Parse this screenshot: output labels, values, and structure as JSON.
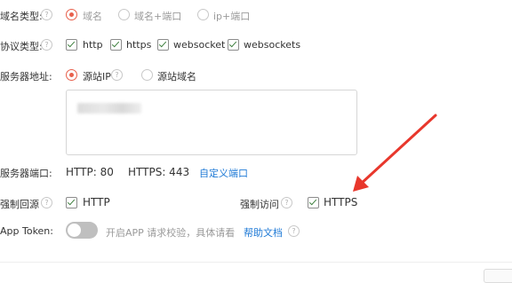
{
  "domain_type": {
    "label": "域名类型:",
    "options": [
      "域名",
      "域名+端口",
      "ip+端口"
    ],
    "selected": "域名"
  },
  "protocol_type": {
    "label": "协议类型:",
    "options": [
      "http",
      "https",
      "websocket",
      "websockets"
    ]
  },
  "server_address": {
    "label": "服务器地址:",
    "options": [
      "源站IP",
      "源站域名"
    ],
    "selected": "源站IP"
  },
  "server_port": {
    "label": "服务器端口:",
    "http": "HTTP: 80",
    "https": "HTTPS: 443",
    "custom_link": "自定义端口"
  },
  "force_origin": {
    "label": "强制回源",
    "option": "HTTP"
  },
  "force_access": {
    "label": "强制访问",
    "option": "HTTPS"
  },
  "app_token": {
    "label": "App Token:",
    "hint": "开启APP 请求校验，具体请看",
    "help_link": "帮助文档"
  },
  "colors": {
    "accent_radio": "#e8604c",
    "link": "#1f7ad6",
    "annotation_arrow": "#e8372c"
  }
}
